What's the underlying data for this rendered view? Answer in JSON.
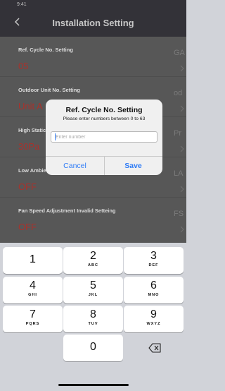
{
  "status_bar": {
    "time": "9:41"
  },
  "header": {
    "title": "Installation Setting"
  },
  "settings": [
    {
      "label": "Ref. Cycle No. Setting",
      "value": "05",
      "right_label": "GA"
    },
    {
      "label": "Outdoor Unit No. Setting",
      "value": "Unit A",
      "right_label": "od"
    },
    {
      "label": "High Static Pressure Setting",
      "value": "30Pa",
      "right_label": "Pr"
    },
    {
      "label": "Low Ambient Cooling Setting",
      "value": "OFF",
      "right_label": "LA"
    },
    {
      "label": "Fan Speed Adjustment Invalid Setteing",
      "value": "OFF",
      "right_label": "FS"
    }
  ],
  "dialog": {
    "title": "Ref. Cycle No. Setting",
    "message": "Please enter numbers between 0 to 63",
    "input_value": "",
    "input_placeholder": "Enter number",
    "cancel_label": "Cancel",
    "save_label": "Save"
  },
  "keyboard": {
    "keys": [
      {
        "digit": "1",
        "letters": ""
      },
      {
        "digit": "2",
        "letters": "ABC"
      },
      {
        "digit": "3",
        "letters": "DEF"
      },
      {
        "digit": "4",
        "letters": "GHI"
      },
      {
        "digit": "5",
        "letters": "JKL"
      },
      {
        "digit": "6",
        "letters": "MNO"
      },
      {
        "digit": "7",
        "letters": "PQRS"
      },
      {
        "digit": "8",
        "letters": "TUV"
      },
      {
        "digit": "9",
        "letters": "WXYZ"
      },
      {
        "digit": "0",
        "letters": ""
      }
    ],
    "backspace_icon": "backspace-icon"
  },
  "colors": {
    "header_bg": "#333238",
    "content_bg": "#575757",
    "value_red": "#a8322c",
    "accent_blue": "#2f7cf6",
    "keyboard_bg": "#d1d3d9"
  }
}
